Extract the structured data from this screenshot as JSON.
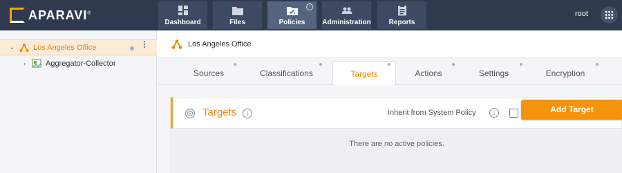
{
  "app": {
    "brand": "APARAVI",
    "brand_mark": "®",
    "user": "root"
  },
  "nav": {
    "tabs": [
      {
        "label": "Dashboard",
        "icon": "dashboard-icon",
        "active": false
      },
      {
        "label": "Files",
        "icon": "folder-icon",
        "active": false
      },
      {
        "label": "Policies",
        "icon": "policies-folder-icon",
        "active": true,
        "info_badge": "i"
      },
      {
        "label": "Administration",
        "icon": "users-icon",
        "active": false
      },
      {
        "label": "Reports",
        "icon": "clipboard-icon",
        "active": false
      }
    ]
  },
  "sidebar": {
    "items": [
      {
        "label": "Los Angeles Office",
        "chevron": "⌄",
        "icon": "node-network-icon",
        "selected": true,
        "menu": "⋮"
      },
      {
        "label": "Aggregator-Collector",
        "chevron": "›",
        "icon": "collector-icon",
        "selected": false
      }
    ]
  },
  "main": {
    "header_title": "Los Angeles Office",
    "tabs": [
      {
        "label": "Sources",
        "active": false
      },
      {
        "label": "Classifications",
        "active": false
      },
      {
        "label": "Targets",
        "active": true
      },
      {
        "label": "Actions",
        "active": false
      },
      {
        "label": "Settings",
        "active": false
      },
      {
        "label": "Encryption",
        "active": false
      }
    ],
    "card": {
      "title": "Targets",
      "info": "i",
      "inherit_label": "Inherit from System Policy",
      "inherit_checked": false,
      "add_button": "Add Target",
      "empty_message": "There are no active policies."
    }
  },
  "colors": {
    "topbar": "#2f3a4e",
    "accent": "#f5940c",
    "accent_text": "#e8860c",
    "selected_bg": "#fcebd6"
  }
}
